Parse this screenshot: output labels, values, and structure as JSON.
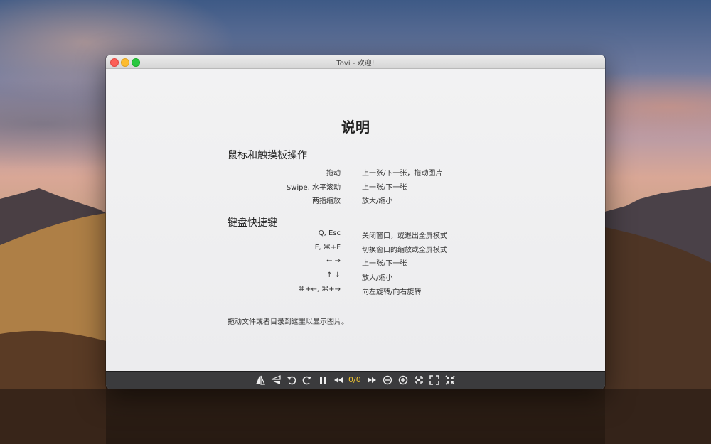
{
  "window": {
    "title": "Tovi - 欢迎!"
  },
  "help": {
    "title": "说明",
    "sections": [
      {
        "heading": "鼠标和触摸板操作",
        "rows": [
          {
            "key": "拖动",
            "desc": "上一张/下一张，拖动图片"
          },
          {
            "key": "Swipe, 水平滚动",
            "desc": "上一张/下一张"
          },
          {
            "key": "两指缩放",
            "desc": "放大/缩小"
          }
        ]
      },
      {
        "heading": "键盘快捷键",
        "rows": [
          {
            "key": "Q, Esc",
            "desc": "关闭窗口，或退出全屏模式"
          },
          {
            "key": "F, ⌘+F",
            "desc": "切换窗口的缩放或全屏模式"
          },
          {
            "key": "←   →",
            "desc": "上一张/下一张"
          },
          {
            "key": "↑   ↓",
            "desc": "放大/缩小"
          },
          {
            "key": "⌘+←, ⌘+→",
            "desc": "向左旋转/向右旋转"
          }
        ]
      }
    ],
    "footer": "拖动文件或者目录到这里以显示图片。"
  },
  "toolbar": {
    "counter": "0/0",
    "counter_color": "#f3c730",
    "icons": [
      "flip-horizontal-icon",
      "flip-vertical-icon",
      "rotate-left-icon",
      "rotate-right-icon",
      "pause-icon",
      "previous-icon",
      "next-icon",
      "zoom-out-icon",
      "zoom-in-icon",
      "fit-window-icon",
      "fullscreen-icon",
      "actual-size-icon"
    ]
  }
}
